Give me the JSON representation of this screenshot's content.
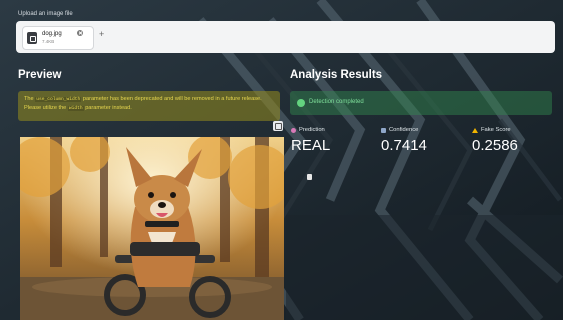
{
  "upload": {
    "label": "Upload an image file",
    "file_name": "dog.jpg",
    "file_size": "7.4KB",
    "add_symbol": "+"
  },
  "preview": {
    "title": "Preview",
    "warning_pre": "The ",
    "warning_code1": "use_column_width",
    "warning_mid": " parameter has been deprecated and will be removed in a future release.",
    "warning_line2_pre": "Please utilize the ",
    "warning_code2": "width",
    "warning_line2_post": " parameter instead."
  },
  "results": {
    "title": "Analysis Results",
    "status_text": "Detection completed",
    "prediction_label": "Prediction",
    "prediction_value": "REAL",
    "confidence_label": "Confidence",
    "confidence_value": "0.7414",
    "fake_score_label": "Fake Score",
    "fake_score_value": "0.2586"
  },
  "icons": {
    "file": "image-file-icon",
    "close": "close-icon",
    "success": "check-circle-icon",
    "prediction": "target-icon",
    "confidence": "bar-chart-icon",
    "fake_score": "warning-icon",
    "expand": "fullscreen-icon",
    "document": "document-icon"
  },
  "colors": {
    "background": "#1f2b33",
    "warning_bg": "#968c1e",
    "warning_text": "#e6d64e",
    "success_bg": "#328c50",
    "success_text": "#7fe09b"
  }
}
